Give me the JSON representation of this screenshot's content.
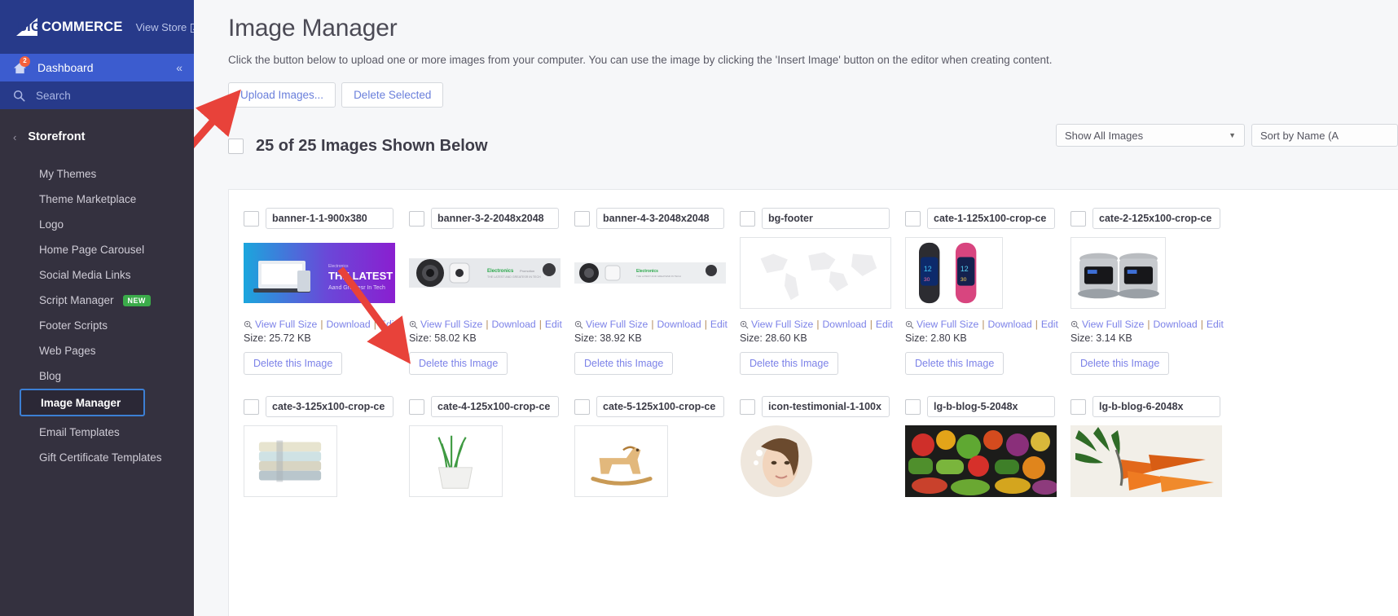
{
  "sidebar": {
    "brand": {
      "text": "COMMERCE",
      "prefix": "BIG"
    },
    "view_store": "View Store",
    "dashboard": {
      "label": "Dashboard",
      "badge": "2"
    },
    "search": {
      "label": "Search"
    },
    "section": {
      "title": "Storefront"
    },
    "items": [
      {
        "label": "My Themes",
        "badge": ""
      },
      {
        "label": "Theme Marketplace",
        "badge": ""
      },
      {
        "label": "Logo",
        "badge": ""
      },
      {
        "label": "Home Page Carousel",
        "badge": ""
      },
      {
        "label": "Social Media Links",
        "badge": ""
      },
      {
        "label": "Script Manager",
        "badge": "NEW"
      },
      {
        "label": "Footer Scripts",
        "badge": ""
      },
      {
        "label": "Web Pages",
        "badge": ""
      },
      {
        "label": "Blog",
        "badge": ""
      },
      {
        "label": "Image Manager",
        "badge": ""
      },
      {
        "label": "Email Templates",
        "badge": ""
      },
      {
        "label": "Gift Certificate Templates",
        "badge": ""
      }
    ]
  },
  "main": {
    "title": "Image Manager",
    "description": "Click the button below to upload one or more images from your computer. You can use the image by clicking the 'Insert Image' button on the editor when creating content.",
    "upload_button": "Upload Images...",
    "delete_selected_button": "Delete Selected",
    "filter_select": "Show All Images",
    "sort_select": "Sort by Name (A",
    "count_text": "25 of 25 Images Shown Below"
  },
  "card_labels": {
    "view_full_size": "View Full Size",
    "download": "Download",
    "edit": "Edit",
    "delete": "Delete this Image",
    "separator": "|"
  },
  "images": [
    {
      "name": "banner-1-1-900x380",
      "size": "Size: 25.72 KB",
      "thumb": "banner-laptop"
    },
    {
      "name": "banner-3-2-2048x2048",
      "size": "Size: 58.02 KB",
      "thumb": "banner-camera"
    },
    {
      "name": "banner-4-3-2048x2048",
      "size": "Size: 38.92 KB",
      "thumb": "banner-electronics"
    },
    {
      "name": "bg-footer",
      "size": "Size: 28.60 KB",
      "thumb": "map-light"
    },
    {
      "name": "cate-1-125x100-crop-ce",
      "size": "Size: 2.80 KB",
      "thumb": "watches"
    },
    {
      "name": "cate-2-125x100-crop-ce",
      "size": "Size: 3.14 KB",
      "thumb": "cookers"
    },
    {
      "name": "cate-3-125x100-crop-ce",
      "size": "",
      "thumb": "towels"
    },
    {
      "name": "cate-4-125x100-crop-ce",
      "size": "",
      "thumb": "plant"
    },
    {
      "name": "cate-5-125x100-crop-ce",
      "size": "",
      "thumb": "rocking-horse"
    },
    {
      "name": "icon-testimonial-1-100x",
      "size": "",
      "thumb": "portrait"
    },
    {
      "name": "lg-b-blog-5-2048x",
      "size": "",
      "thumb": "vegetables"
    },
    {
      "name": "lg-b-blog-6-2048x",
      "size": "",
      "thumb": "carrots"
    }
  ],
  "colors": {
    "brand_blue": "#273a8a",
    "sidebar_dark": "#34313f",
    "accent_link": "#7c82e8",
    "active_outline": "#3c7fd4",
    "new_badge": "#3bab4a",
    "arrow_red": "#e8423a"
  }
}
